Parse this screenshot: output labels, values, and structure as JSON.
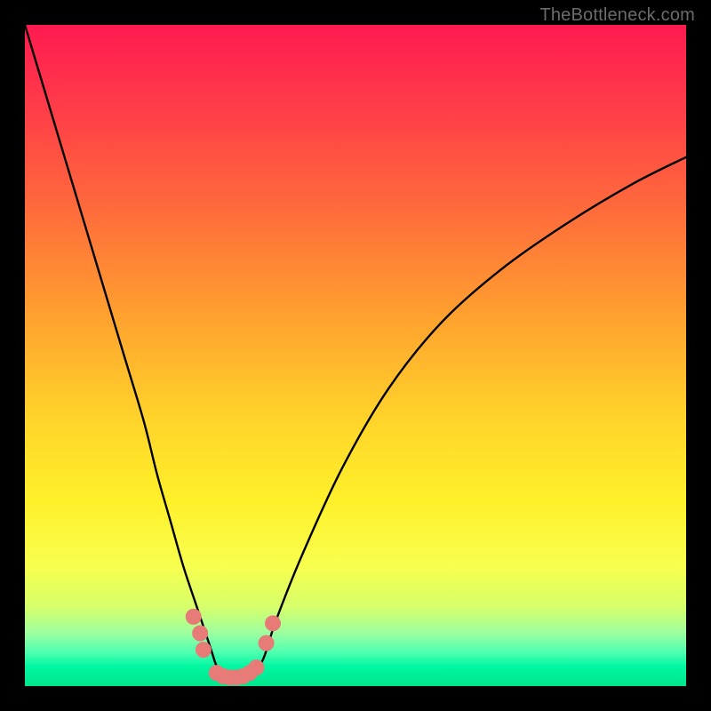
{
  "watermark": {
    "text": "TheBottleneck.com"
  },
  "colors": {
    "curve_stroke": "#000000",
    "marker_fill": "#e77b78",
    "marker_stroke": "#e77b78"
  },
  "chart_data": {
    "type": "line",
    "title": "",
    "xlabel": "",
    "ylabel": "",
    "xlim": [
      0,
      100
    ],
    "ylim": [
      0,
      100
    ],
    "grid": false,
    "series": [
      {
        "name": "bottleneck-curve",
        "x": [
          0,
          3,
          6,
          9,
          12,
          15,
          18,
          20,
          22,
          24,
          26,
          28,
          29,
          30,
          31,
          32,
          34,
          36,
          38,
          42,
          48,
          55,
          63,
          72,
          82,
          92,
          100
        ],
        "values": [
          100,
          90,
          80,
          70,
          60,
          50,
          40,
          32,
          25,
          18,
          12,
          6,
          3,
          1.5,
          1,
          1,
          1.5,
          4,
          10,
          20,
          33,
          45,
          55,
          63,
          70,
          76,
          80
        ]
      }
    ],
    "markers": [
      {
        "x": 25.5,
        "y": 10.5
      },
      {
        "x": 26.5,
        "y": 8.0
      },
      {
        "x": 27.0,
        "y": 5.5
      },
      {
        "x": 29.0,
        "y": 2.0
      },
      {
        "x": 30.0,
        "y": 1.5
      },
      {
        "x": 31.0,
        "y": 1.3
      },
      {
        "x": 32.0,
        "y": 1.3
      },
      {
        "x": 33.0,
        "y": 1.5
      },
      {
        "x": 34.0,
        "y": 2.0
      },
      {
        "x": 35.0,
        "y": 2.8
      },
      {
        "x": 36.5,
        "y": 6.5
      },
      {
        "x": 37.5,
        "y": 9.5
      }
    ]
  }
}
